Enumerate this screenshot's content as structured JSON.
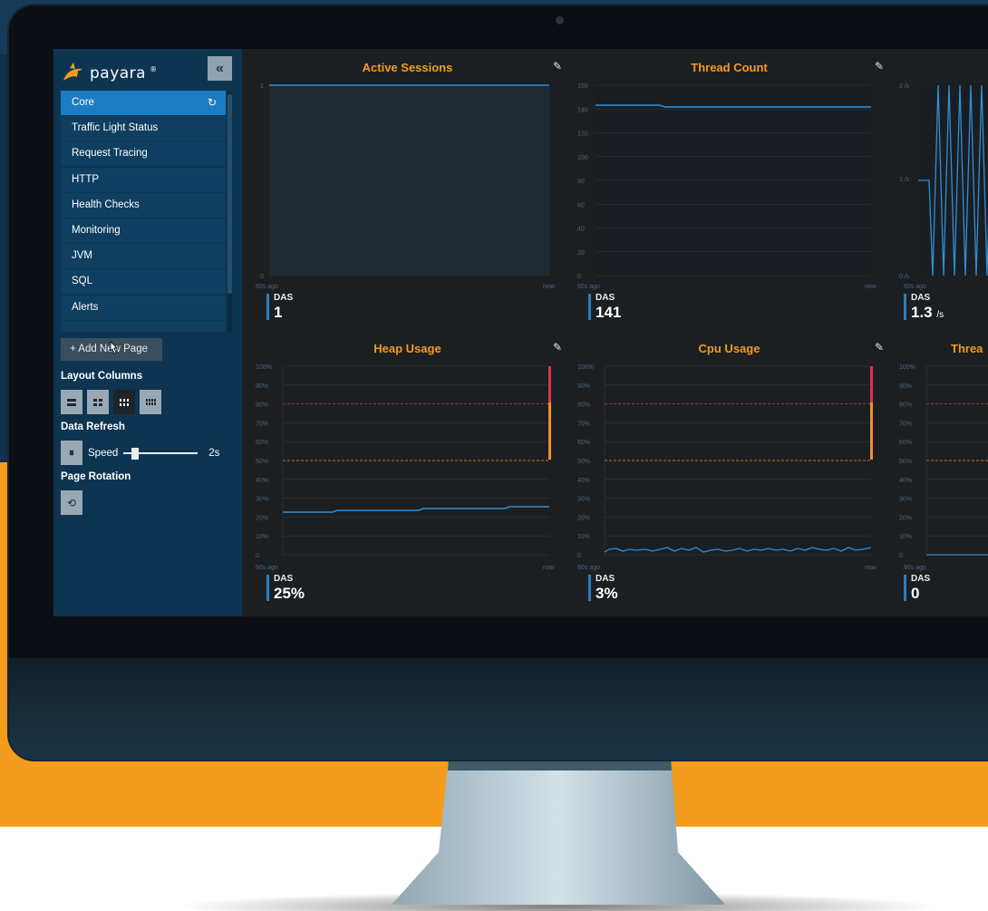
{
  "sidebar": {
    "logo_text": "payara",
    "logo_mark": "®",
    "collapse_icon": "«",
    "nav": [
      {
        "label": "Core",
        "active": true
      },
      {
        "label": "Traffic Light Status"
      },
      {
        "label": "Request Tracing"
      },
      {
        "label": "HTTP"
      },
      {
        "label": "Health Checks"
      },
      {
        "label": "Monitoring"
      },
      {
        "label": "JVM"
      },
      {
        "label": "SQL"
      },
      {
        "label": "Alerts"
      }
    ],
    "reload_icon": "↻",
    "add_page_label": "+  Add New Page",
    "layout_columns_title": "Layout Columns",
    "data_refresh_title": "Data Refresh",
    "pause_icon": "⏸",
    "speed_label": "Speed",
    "speed_value": "2s",
    "speed_level": 0.15,
    "page_rotation_title": "Page Rotation",
    "rotate_icon": "⟲"
  },
  "panels": [
    {
      "title": "Active Sessions",
      "source": "DAS",
      "value": "1",
      "unit": ""
    },
    {
      "title": "Thread Count",
      "source": "DAS",
      "value": "141",
      "unit": ""
    },
    {
      "title": "",
      "source": "DAS",
      "value": "1.3",
      "unit": "/s"
    },
    {
      "title": "Heap Usage",
      "source": "DAS",
      "value": "25%",
      "unit": ""
    },
    {
      "title": "Cpu Usage",
      "source": "DAS",
      "value": "3%",
      "unit": ""
    },
    {
      "title": "Threa",
      "source": "DAS",
      "value": "0",
      "unit": ""
    }
  ],
  "edit_icon": "✎",
  "axis": {
    "start_label": "60s ago",
    "end_label": "now",
    "sessions_ticks": [
      "0",
      "1"
    ],
    "thread_ticks": [
      "0",
      "20",
      "40",
      "60",
      "80",
      "100",
      "120",
      "140",
      "160"
    ],
    "rate_ticks": [
      "0 /s",
      "1 /s",
      "2 /s"
    ],
    "percent_ticks": [
      "0",
      "10%",
      "20%",
      "30%",
      "40%",
      "50%",
      "60%",
      "70%",
      "80%",
      "90%",
      "100%"
    ]
  },
  "colors": {
    "accent": "#f39c1e",
    "line": "#2f8fd6",
    "alarm": "#e0314f",
    "warning": "#f0902a",
    "sidebar": "#0d3552"
  }
}
